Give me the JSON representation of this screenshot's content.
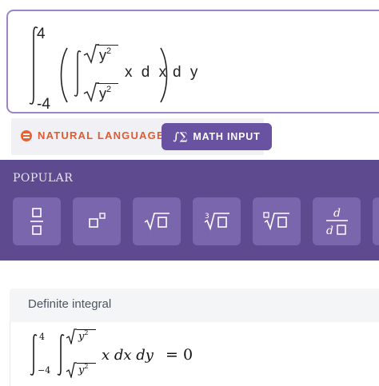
{
  "input": {
    "upper_limit": "4",
    "lower_limit": "-4",
    "inner_upper_radicand": "y",
    "inner_upper_exponent": "2",
    "inner_lower_radicand": "y",
    "inner_lower_exponent": "2",
    "integrand": "x d x",
    "outer_differential": "d y"
  },
  "mode_toggle": {
    "natural_language_label": "NATURAL LANGUAGE",
    "natural_language_icon": "equals-badge-icon",
    "math_input_label": "MATH INPUT",
    "math_input_icon": "integral-sum-icon",
    "selected": "math_input"
  },
  "palette": {
    "title": "POPULAR",
    "buttons": [
      {
        "name": "fraction",
        "icon": "fraction-icon"
      },
      {
        "name": "superscript",
        "icon": "superscript-icon"
      },
      {
        "name": "square-root",
        "icon": "square-root-icon"
      },
      {
        "name": "cube-root",
        "icon": "cube-root-icon"
      },
      {
        "name": "nth-root",
        "icon": "nth-root-icon"
      },
      {
        "name": "derivative",
        "icon": "derivative-icon",
        "numerator": "d",
        "denominator": "d"
      }
    ]
  },
  "result": {
    "title": "Definite integral",
    "upper_limit": "4",
    "lower_limit": "−4",
    "inner_upper_radicand": "y",
    "inner_upper_exponent": "2",
    "inner_lower_radicand": "y",
    "inner_lower_exponent": "2",
    "expression": "x dx dy",
    "equals": "=",
    "value": "0"
  },
  "colors": {
    "accent_purple": "#6a52a2",
    "palette_background": "#5d4a8f",
    "palette_button": "#7a66ad",
    "natural_language_orange": "#e35a2e",
    "input_border": "#9b85c8"
  }
}
